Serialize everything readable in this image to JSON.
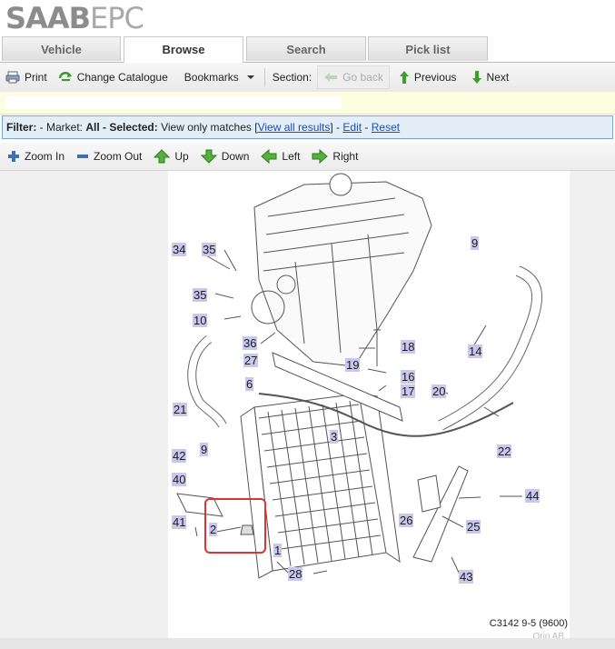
{
  "brand": {
    "name_bold": "SAAB",
    "name_light": "EPC"
  },
  "tabs": [
    {
      "label": "Vehicle",
      "active": false
    },
    {
      "label": "Browse",
      "active": true
    },
    {
      "label": "Search",
      "active": false
    },
    {
      "label": "Pick list",
      "active": false
    }
  ],
  "toolbar": {
    "print": "Print",
    "change_catalogue": "Change Catalogue",
    "bookmarks": "Bookmarks",
    "section": "Section:",
    "go_back": "Go back",
    "previous": "Previous",
    "next": "Next"
  },
  "filter": {
    "prefix": "Filter:",
    "market_label": " - Market: ",
    "market_value": "All",
    "selected_label": " - Selected: ",
    "selected_value": "View only matches ",
    "view_all": "View all results",
    "edit": "Edit",
    "reset": "Reset"
  },
  "zoom": {
    "zoom_in": "Zoom In",
    "zoom_out": "Zoom Out",
    "up": "Up",
    "down": "Down",
    "left": "Left",
    "right": "Right"
  },
  "diagram": {
    "labels": [
      "1",
      "2",
      "3",
      "6",
      "9",
      "9",
      "10",
      "14",
      "16",
      "17",
      "18",
      "19",
      "20",
      "21",
      "22",
      "25",
      "26",
      "27",
      "28",
      "34",
      "35",
      "35",
      "36",
      "40",
      "41",
      "42",
      "43",
      "44"
    ],
    "caption": "C3142 9-5 (9600)",
    "copyright": "Orio AB"
  },
  "colors": {
    "label_bg": "#c8c8ee",
    "highlight": "#dd3333",
    "link": "#1a4db8"
  }
}
